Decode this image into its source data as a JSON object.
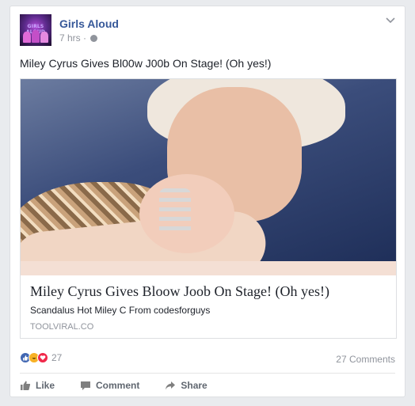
{
  "post": {
    "page_name": "Girls Aloud",
    "avatar_text": "GIRLS ALOUD",
    "time": "7 hrs",
    "separator": "·",
    "text": "Miley Cyrus Gives Bl00w J00b On Stage! (Oh yes!)",
    "link": {
      "title": "Miley Cyrus Gives Bloow Joob On Stage! (Oh yes!)",
      "description": "Scandalus Hot Miley C From codesforguys",
      "domain": "TOOLVIRAL.CO"
    },
    "reactions": {
      "icons": [
        "like-reaction-icon",
        "haha-reaction-icon",
        "love-reaction-icon"
      ],
      "count": "27"
    },
    "comments_count": "27 Comments",
    "actions": {
      "like": "Like",
      "comment": "Comment",
      "share": "Share"
    }
  },
  "colors": {
    "background": "#e9ebee",
    "link_blue": "#365899",
    "muted": "#90949c",
    "like_blue": "#4267b2",
    "love_red": "#f0284a",
    "haha_yellow": "#f7b125"
  }
}
